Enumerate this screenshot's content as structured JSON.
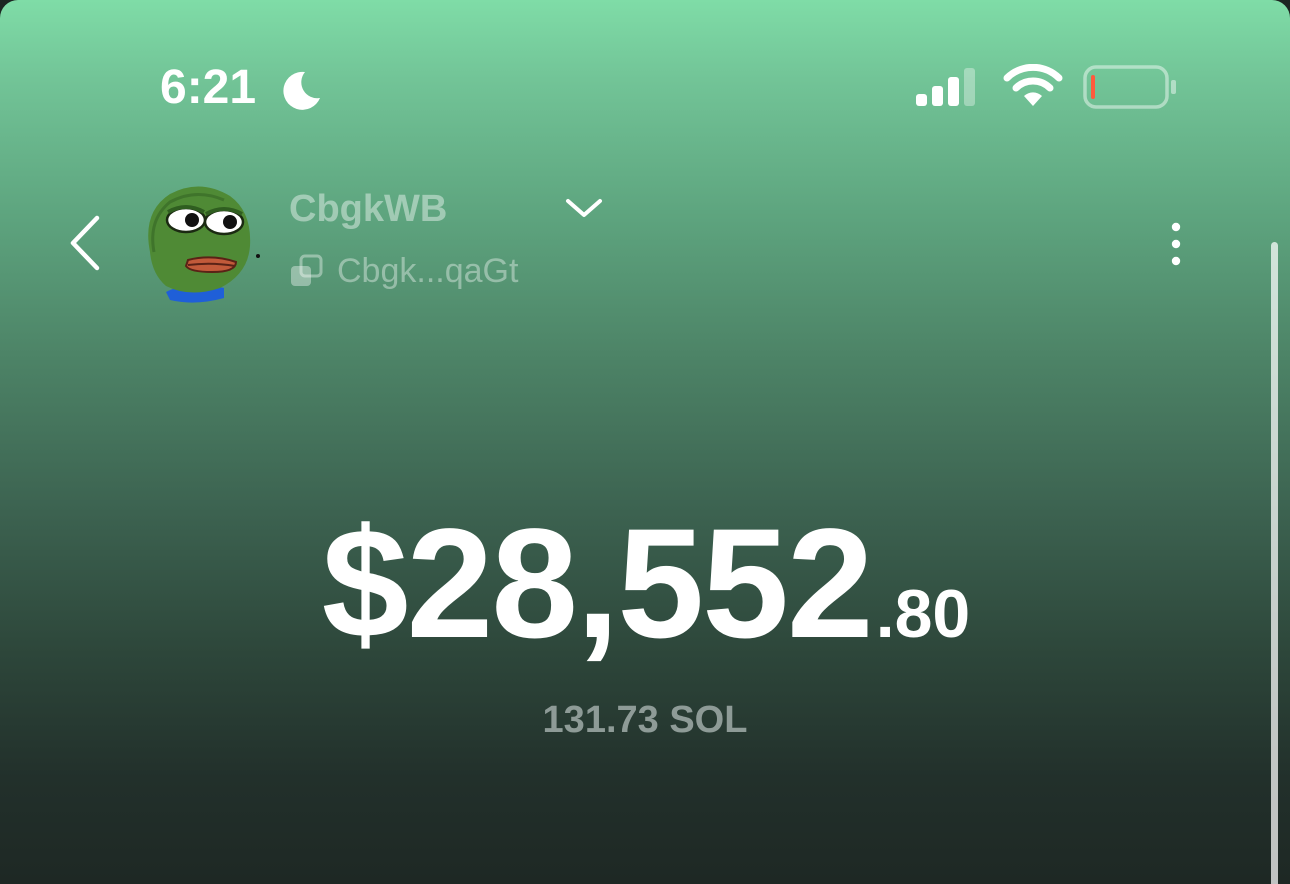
{
  "status_bar": {
    "time": "6:21",
    "focus_icon": "moon-icon",
    "signal_icon": "cellular-signal-icon",
    "wifi_icon": "wifi-icon",
    "battery_icon": "battery-low-icon",
    "battery_level": 0.05,
    "battery_color": "#ff5a3c"
  },
  "header": {
    "back_icon": "chevron-left-icon",
    "avatar_icon": "pepe-frog-avatar",
    "account_name": "CbgkWB",
    "dropdown_icon": "chevron-down-icon",
    "copy_icon": "copy-icon",
    "address_short": "Cbgk...qaGt",
    "more_icon": "vertical-ellipsis-icon"
  },
  "balance": {
    "usd_main": "$28,552",
    "usd_cents": ".80",
    "sol_amount": "131.73 SOL"
  },
  "colors": {
    "gradient_top": "#7fdca7",
    "gradient_bottom": "#1e2824",
    "secondary_text": "#8e9b97"
  }
}
